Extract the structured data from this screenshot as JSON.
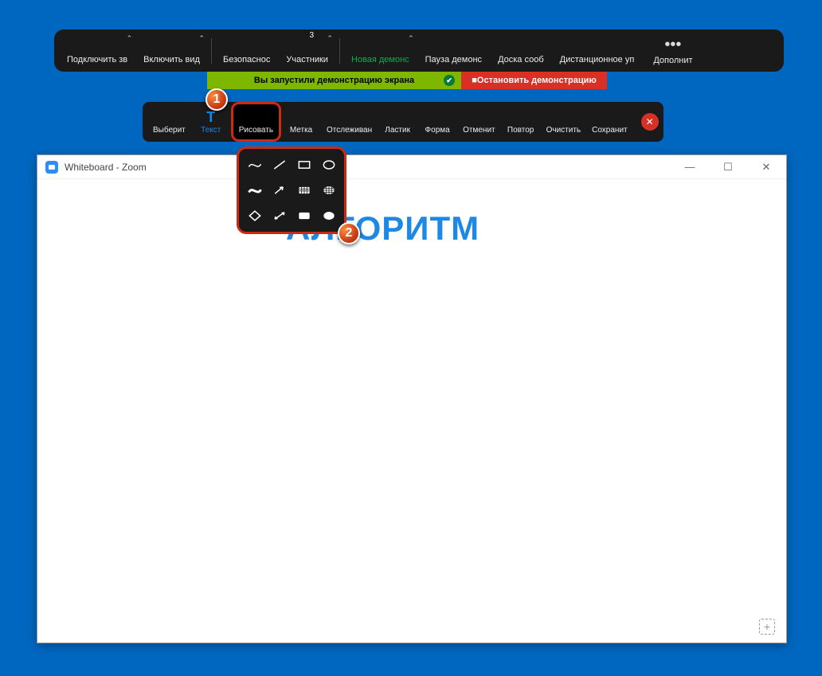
{
  "top": {
    "audio": "Подключить зв",
    "video": "Включить вид",
    "security": "Безопаснос",
    "participants": "Участники",
    "participants_count": "3",
    "new_share": "Новая демонс",
    "pause_share": "Пауза демонс",
    "whiteboard": "Доска сооб",
    "remote": "Дистанционное уп",
    "more": "Дополнит"
  },
  "strip": {
    "sharing": "Вы запустили демонстрацию экрана",
    "stop": "Остановить демонстрацию"
  },
  "anno": {
    "select": "Выберит",
    "text": "Текст",
    "draw": "Рисовать",
    "stamp": "Метка",
    "spotlight": "Отслеживан",
    "eraser": "Ластик",
    "format": "Форма",
    "undo": "Отменит",
    "redo": "Повтор",
    "clear": "Очистить",
    "save": "Сохранит"
  },
  "win": {
    "title": "Whiteboard - Zoom",
    "body_text": "АЛГОРИТМ"
  },
  "badges": {
    "one": "1",
    "two": "2"
  }
}
